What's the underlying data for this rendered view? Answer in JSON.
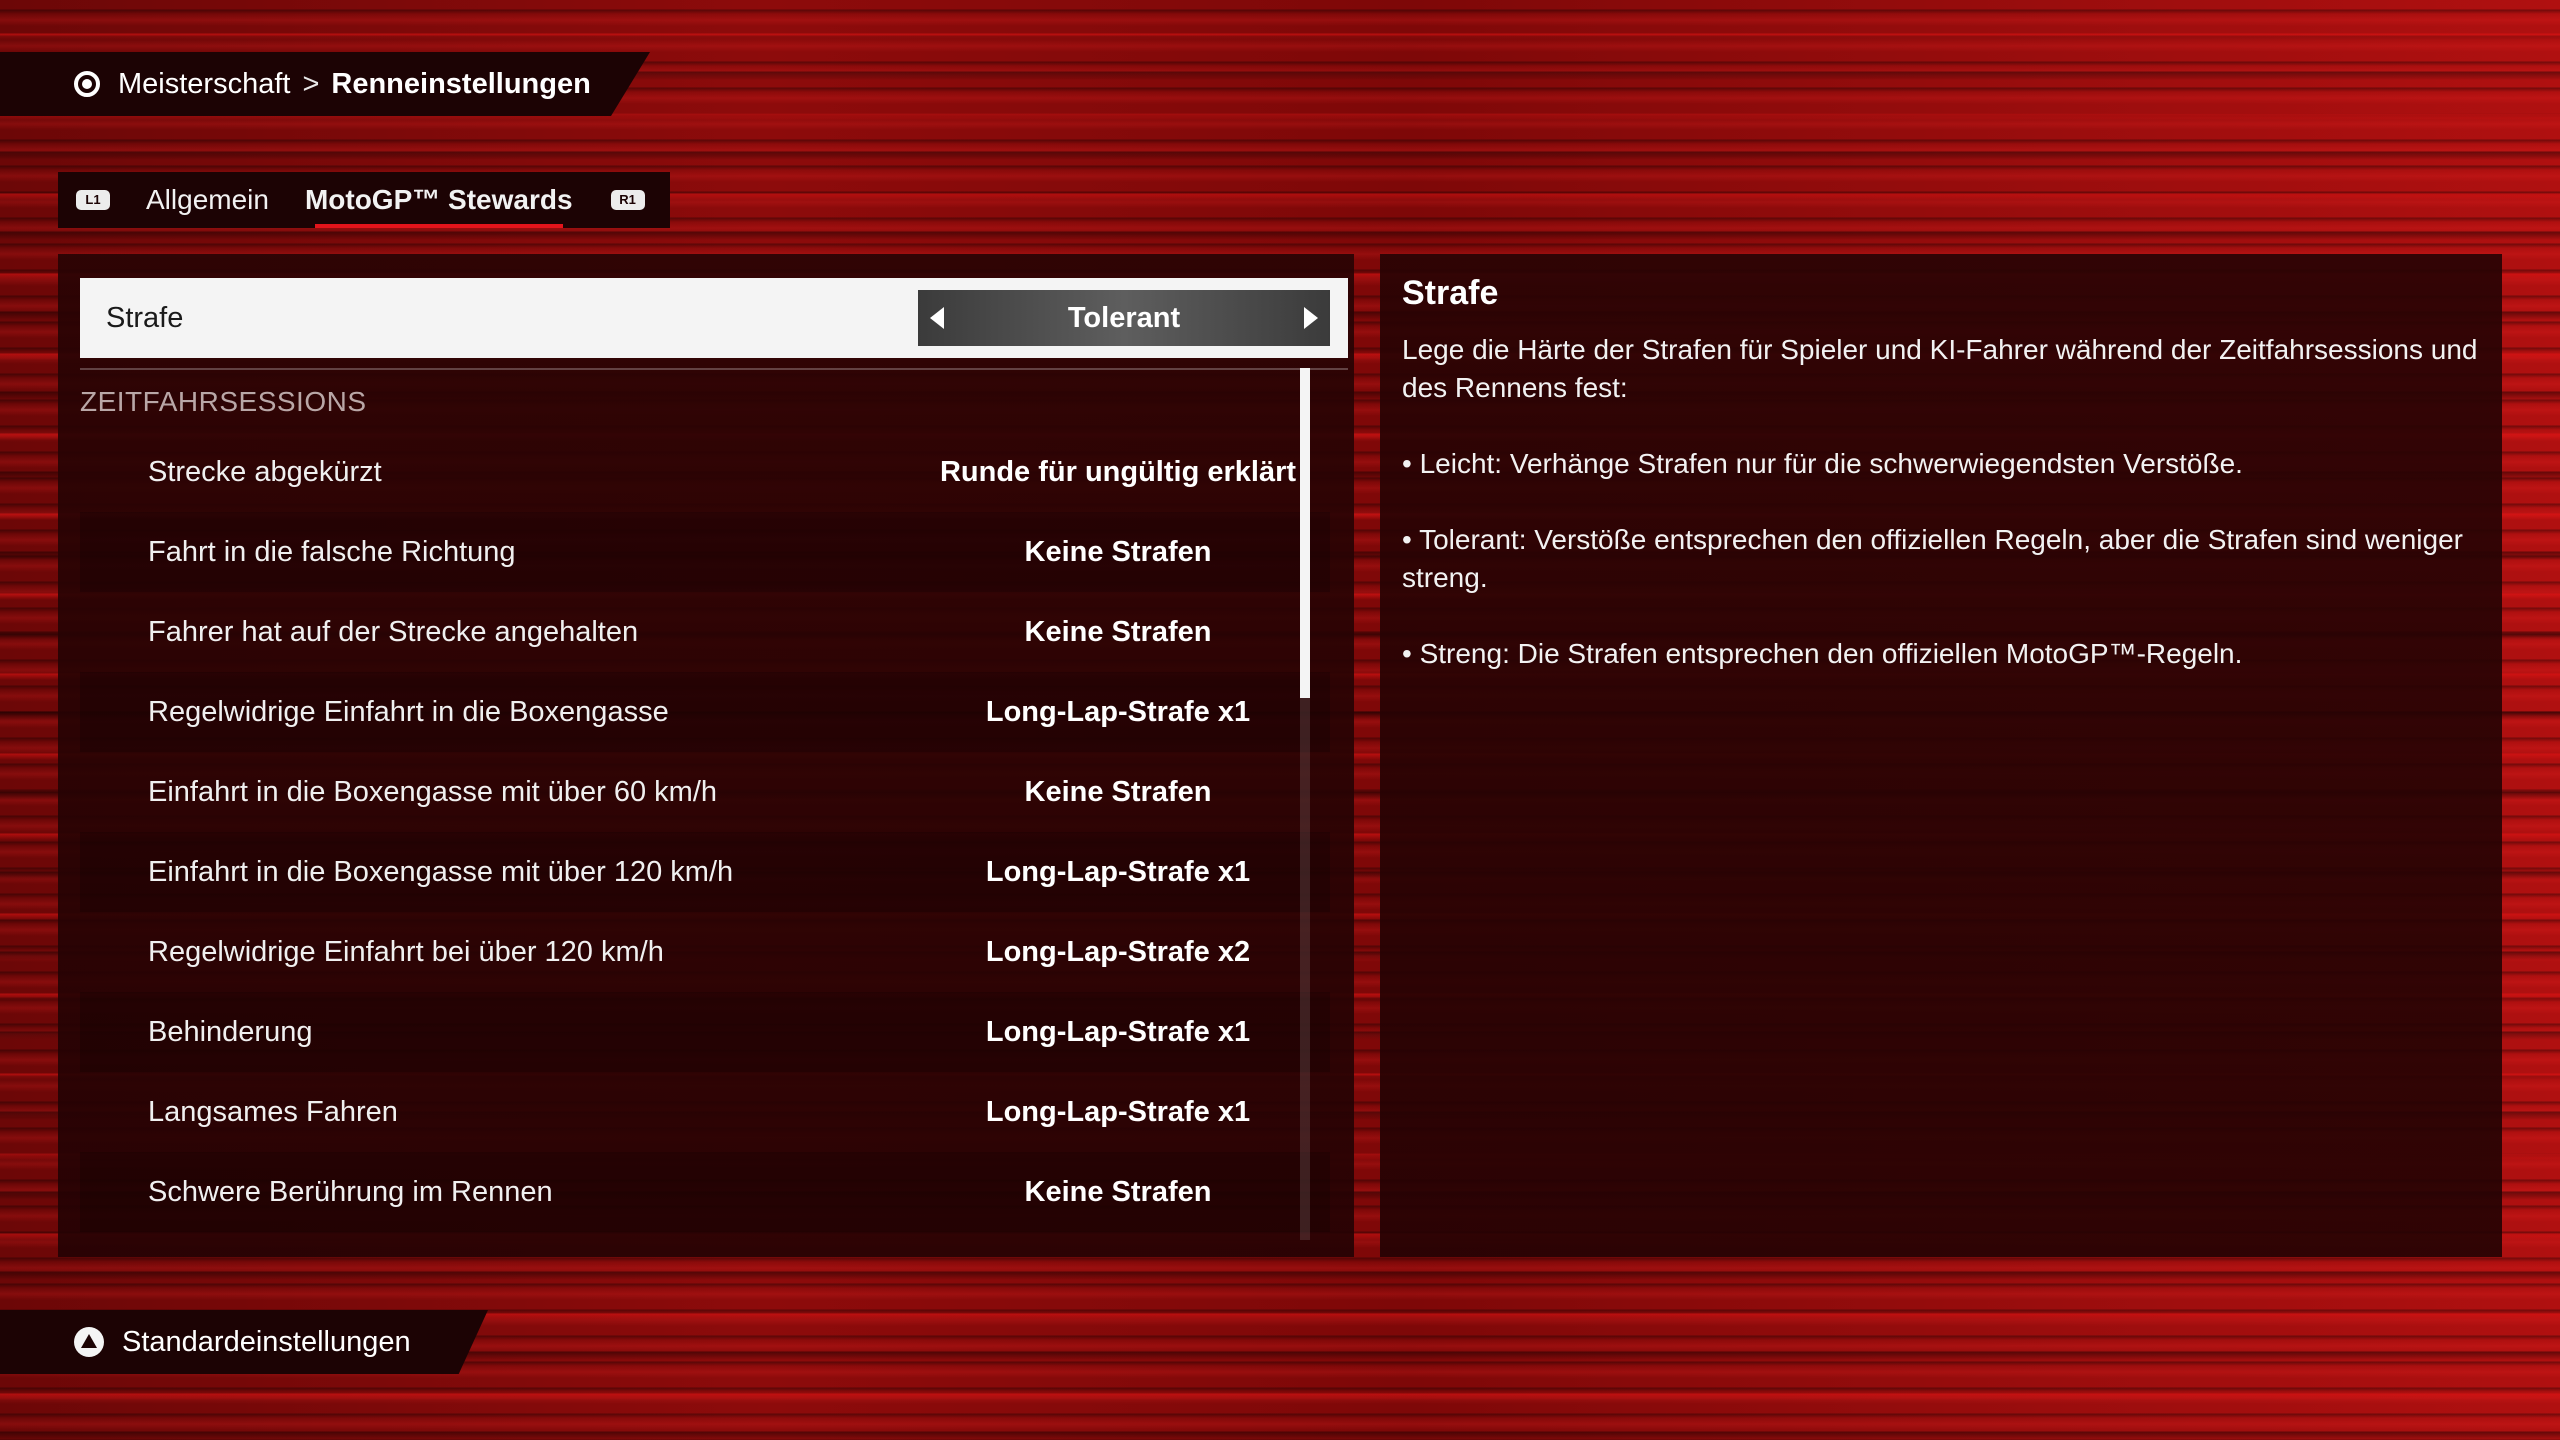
{
  "breadcrumb": {
    "parent": "Meisterschaft",
    "separator": ">",
    "current": "Renneinstellungen"
  },
  "tabs": {
    "left_button": "L1",
    "right_button": "R1",
    "items": [
      {
        "label": "Allgemein",
        "active": false
      },
      {
        "label": "MotoGP™ Stewards",
        "active": true
      }
    ]
  },
  "selected_setting": {
    "label": "Strafe",
    "value": "Tolerant"
  },
  "section": {
    "title": "ZEITFAHRSESSIONS"
  },
  "rows": [
    {
      "label": "Strecke abgekürzt",
      "value": "Runde für ungültig erklärt"
    },
    {
      "label": "Fahrt in die falsche Richtung",
      "value": "Keine Strafen"
    },
    {
      "label": "Fahrer hat auf der Strecke angehalten",
      "value": "Keine Strafen"
    },
    {
      "label": "Regelwidrige Einfahrt in die Boxengasse",
      "value": "Long-Lap-Strafe x1"
    },
    {
      "label": "Einfahrt in die Boxengasse mit über 60 km/h",
      "value": "Keine Strafen"
    },
    {
      "label": "Einfahrt in die Boxengasse mit über 120 km/h",
      "value": "Long-Lap-Strafe x1"
    },
    {
      "label": "Regelwidrige Einfahrt bei über 120 km/h",
      "value": "Long-Lap-Strafe x2"
    },
    {
      "label": "Behinderung",
      "value": "Long-Lap-Strafe x1"
    },
    {
      "label": "Langsames Fahren",
      "value": "Long-Lap-Strafe x1"
    },
    {
      "label": "Schwere Berührung im Rennen",
      "value": "Keine Strafen"
    }
  ],
  "description": {
    "title": "Strafe",
    "paragraphs": [
      "Lege die Härte der Strafen für Spieler und KI-Fahrer während der Zeitfahrsessions und des Rennens fest:",
      "• Leicht: Verhänge Strafen nur für die schwerwiegendsten Verstöße.",
      "• Tolerant: Verstöße entsprechen den offiziellen Regeln, aber die Strafen sind weniger streng.",
      "• Streng: Die Strafen entsprechen den offiziellen MotoGP™-Regeln."
    ]
  },
  "footer": {
    "label": "Standardeinstellungen"
  },
  "colors": {
    "accent": "#e3141b",
    "panel": "#280304",
    "selected_row": "#f4f4f4"
  }
}
